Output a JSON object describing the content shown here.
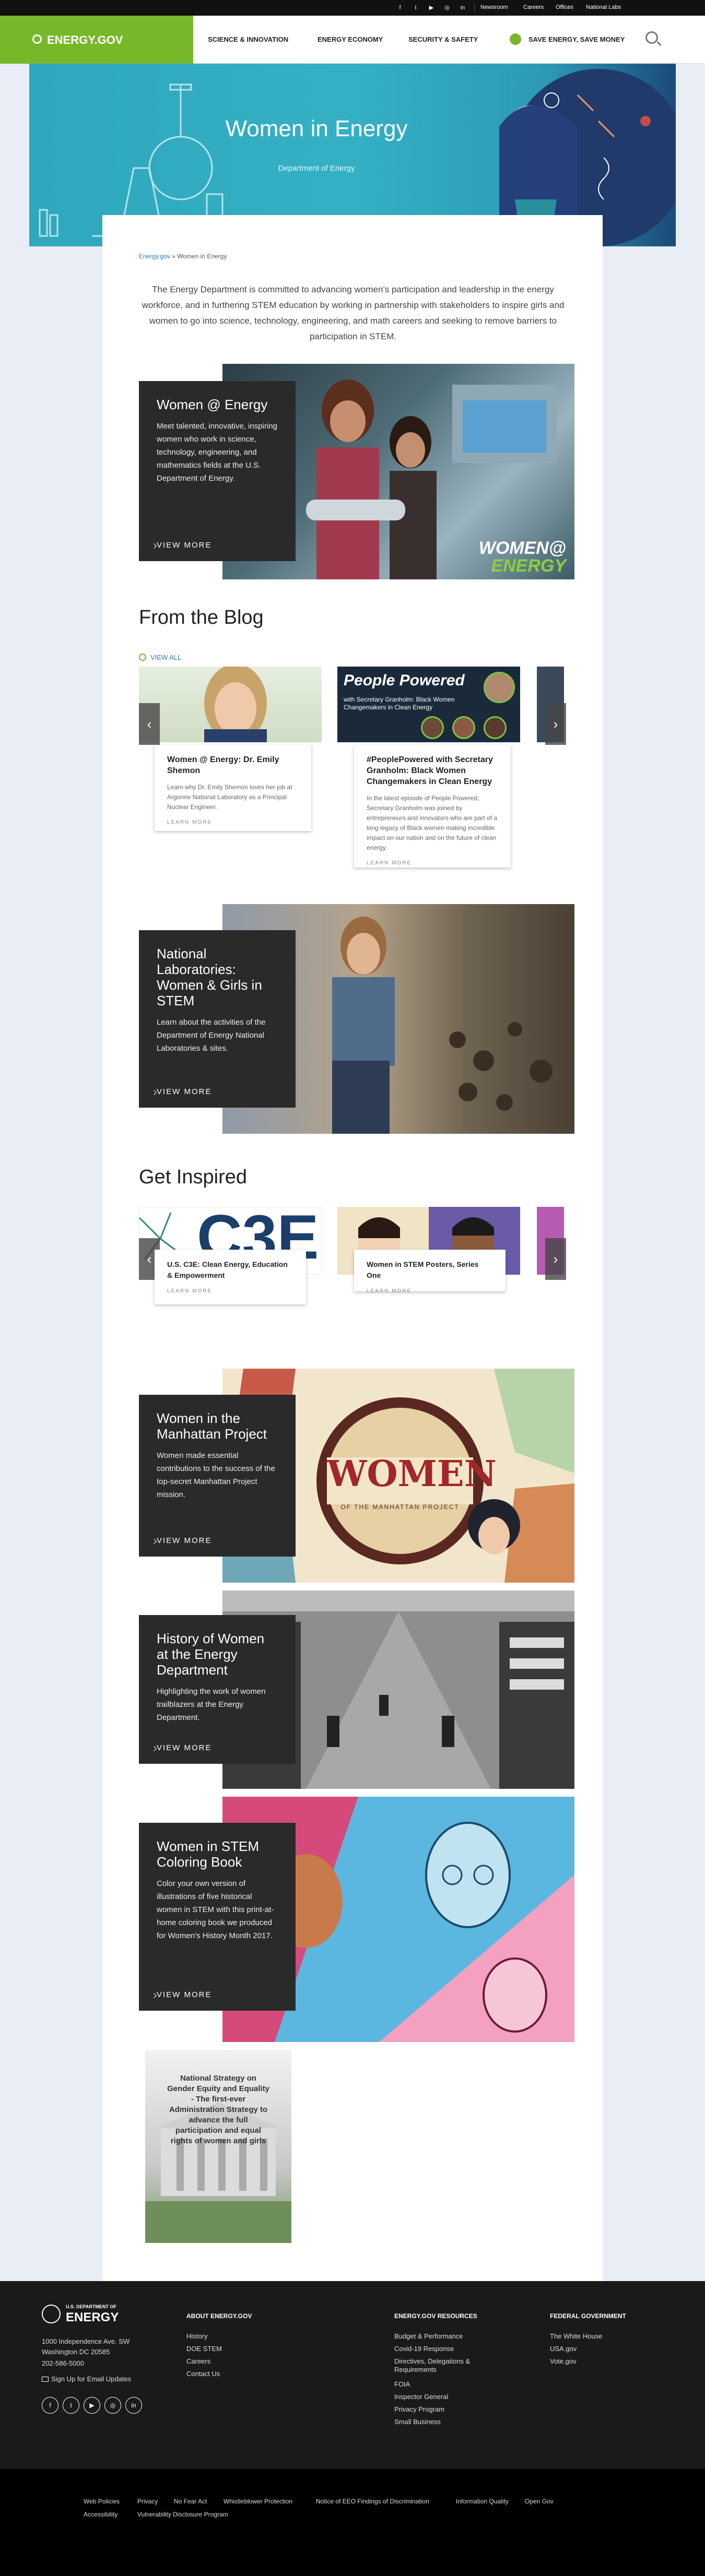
{
  "topbar": {
    "social": [
      "f",
      "t",
      "▶",
      "◎",
      "in"
    ],
    "links": [
      "Newsroom",
      "Careers",
      "Offices",
      "National Labs"
    ]
  },
  "nav": {
    "logo": "ENERGY.GOV",
    "items": [
      "SCIENCE & INNOVATION",
      "ENERGY ECONOMY",
      "SECURITY & SAFETY"
    ],
    "save": "SAVE ENERGY, SAVE MONEY"
  },
  "hero": {
    "title": "Women in Energy",
    "subtitle": "Department of Energy"
  },
  "breadcrumb": {
    "home": "Energy.gov",
    "sep": "»",
    "current": "Women in Energy"
  },
  "intro": "The Energy Department is committed to advancing women’s participation and leadership in the energy workforce, and in furthering STEM education by working in partnership with stakeholders to inspire girls and women to go into science, technology, engineering, and math careers and seeking to remove barriers to participation in STEM.",
  "features": [
    {
      "title": "Women @ Energy",
      "desc": "Meet talented, innovative, inspiring women who work in science, technology, engineering, and mathematics fields at the U.S. Department of Energy.",
      "more": "VIEW MORE",
      "badge1": "WOMEN@",
      "badge2": "ENERGY"
    },
    {
      "title": "National Laboratories: Women & Girls in STEM",
      "desc": "Learn about the activities of the Department of Energy National Laboratories & sites.",
      "more": "VIEW MORE"
    },
    {
      "title": "Women in the Manhattan Project",
      "desc": "Women made essential contributions to the success of the top-secret Manhattan Project mission.",
      "more": "VIEW MORE",
      "art1": "WOMEN",
      "art2": "OF THE MANHATTAN PROJECT"
    },
    {
      "title": "History of Women at the Energy Department",
      "desc": "Highlighting the work of women trailblazers at the Energy Department.",
      "more": "VIEW MORE"
    },
    {
      "title": "Women in STEM Coloring Book",
      "desc": "Color your own version of illustrations of five historical women in STEM with this print-at-home coloring book we produced for Women's History Month 2017.",
      "more": "VIEW MORE"
    }
  ],
  "blog": {
    "heading": "From the Blog",
    "view_all": "VIEW ALL",
    "cards": [
      {
        "title": "Women @ Energy: Dr. Emily Shemon",
        "desc": "Learn why Dr. Emily Shemon loves her job at Argonne National Laboratory as a Principal Nuclear Engineer.",
        "more": "LEARN MORE"
      },
      {
        "title": "#PeoplePowered with Secretary Granholm: Black Women Changemakers in Clean Energy",
        "desc": "In the latest episode of People Powered, Secretary Granholm was joined by entrepreneurs and innovators who are part of a long legacy of Black women making incredible impact on our nation and on the future of clean energy.",
        "more": "LEARN MORE",
        "banner1": "People Powered",
        "banner2": "with Secretary Granholm: Black Women Changemakers in Clean Energy"
      }
    ]
  },
  "inspired": {
    "heading": "Get Inspired",
    "cards": [
      {
        "title": "U.S. C3E: Clean Energy, Education & Empowerment",
        "more": "LEARN MORE",
        "art": "C3E"
      },
      {
        "title": "Women in STEM Posters, Series One",
        "more": "LEARN MORE"
      }
    ]
  },
  "strategy": {
    "text": "National Strategy on Gender Equity and Equality - The first-ever Administration Strategy to advance the full participation and equal rights of women and girls"
  },
  "footer": {
    "logo_small": "U.S. DEPARTMENT OF",
    "logo": "ENERGY",
    "address": [
      "1000 Independence Ave. SW",
      "Washington DC 20585",
      "202-586-5000"
    ],
    "signup": "Sign Up for Email Updates",
    "social": [
      "f",
      "t",
      "▶",
      "◎",
      "in"
    ],
    "cols": [
      {
        "heading": "ABOUT ENERGY.GOV",
        "links": [
          "History",
          "DOE STEM",
          "Careers",
          "Contact Us"
        ]
      },
      {
        "heading": "ENERGY.GOV RESOURCES",
        "links": [
          "Budget & Performance",
          "Covid-19 Response",
          "Directives, Delegations & Requirements",
          "FOIA",
          "Inspector General",
          "Privacy Program",
          "Small Business"
        ]
      },
      {
        "heading": "FEDERAL GOVERNMENT",
        "links": [
          "The White House",
          "USA.gov",
          "Vote.gov"
        ]
      }
    ],
    "bottom_links": [
      "Web Policies",
      "Privacy",
      "No Fear Act",
      "Whistleblower Protection",
      "Notice of EEO Findings of Discrimination",
      "Information Quality",
      "Open Gov",
      "Accessibility",
      "Vulnerability Disclosure Program"
    ]
  }
}
